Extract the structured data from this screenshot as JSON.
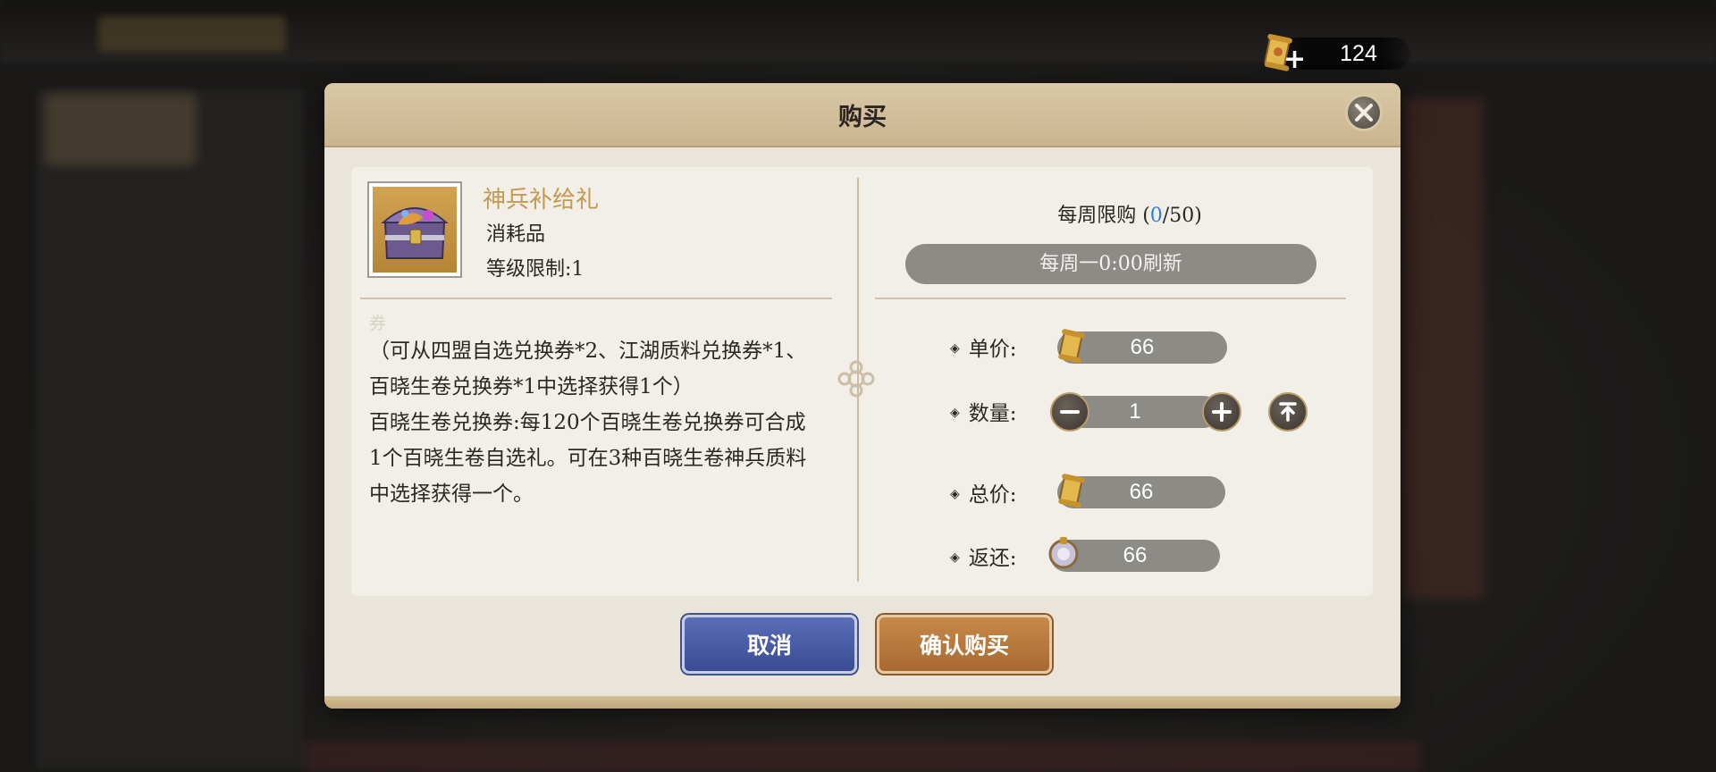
{
  "currency": {
    "value": "124",
    "icon": "scroll-ticket-icon",
    "add_icon": "plus-icon"
  },
  "dialog": {
    "title": "购买",
    "close_icon": "close-icon"
  },
  "item": {
    "name": "神兵补给礼",
    "type": "消耗品",
    "level_limit": "等级限制:1",
    "icon": "treasure-chest-icon",
    "name_color": "#c49a4e"
  },
  "description": {
    "ghost_line": "券",
    "paragraph1": "（可从四盟自选兑换券*2、江湖质料兑换券*1、百晓生卷兑换券*1中选择获得1个）",
    "paragraph2": "百晓生卷兑换券:每120个百晓生卷兑换券可合成1个百晓生卷自选礼。可在3种百晓生卷神兵质料中选择获得一个。"
  },
  "limit": {
    "label": "每周限购",
    "current": "0",
    "max": "50",
    "refresh_text": "每周一0:00刷新"
  },
  "purchase": {
    "unit_price_label": "单价:",
    "unit_price": "66",
    "quantity_label": "数量:",
    "quantity": "1",
    "total_label": "总价:",
    "total": "66",
    "refund_label": "返还:",
    "refund": "66",
    "price_icon": "scroll-ticket-icon",
    "refund_icon": "fan-coin-icon"
  },
  "buttons": {
    "cancel": "取消",
    "confirm": "确认购买"
  },
  "colors": {
    "accent_blue": "#2a7fd8",
    "cancel_button": "#4a5ca6",
    "confirm_button": "#b77a3d"
  }
}
